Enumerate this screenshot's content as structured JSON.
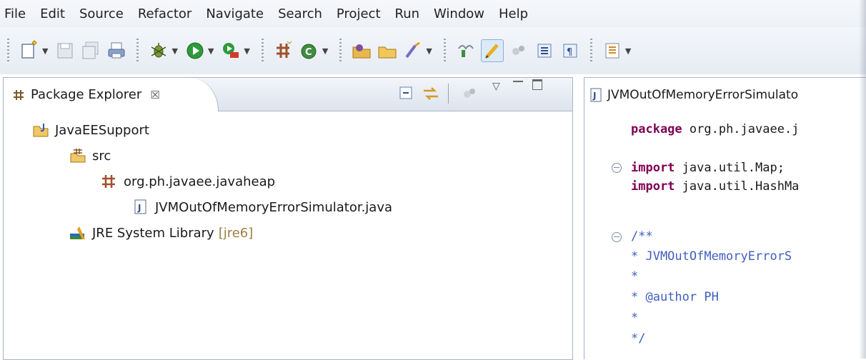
{
  "menu": [
    "File",
    "Edit",
    "Source",
    "Refactor",
    "Navigate",
    "Search",
    "Project",
    "Run",
    "Window",
    "Help"
  ],
  "toolbar": {
    "icons": [
      "new-wizard-icon",
      "save-icon",
      "save-all-icon",
      "print-icon",
      "debug-icon",
      "run-icon",
      "external-tools-icon",
      "new-java-package-icon",
      "new-java-class-icon",
      "open-type-icon",
      "open-task-icon",
      "search-icon",
      "toggle-breadcrumb-icon",
      "mark-occurrences-icon",
      "block-selection-icon",
      "show-source-icon",
      "show-whitespace-icon",
      "next-annotation-icon"
    ]
  },
  "package_explorer": {
    "title": "Package Explorer",
    "close_glyph": "☒",
    "tree": [
      {
        "label": "JavaEESupport",
        "icon": "java-project-icon",
        "depth": 0
      },
      {
        "label": "src",
        "icon": "source-folder-icon",
        "depth": 1
      },
      {
        "label": "org.ph.javaee.javaheap",
        "icon": "package-icon",
        "depth": 2
      },
      {
        "label": "JVMOutOfMemoryErrorSimulator.java",
        "icon": "java-file-icon",
        "depth": 3
      },
      {
        "label": "JRE System Library",
        "decoration": "[jre6]",
        "icon": "library-icon",
        "depth": 1
      }
    ]
  },
  "editor": {
    "tab_title": "JVMOutOfMemoryErrorSimulato",
    "lines": [
      {
        "kw": "package",
        "rest": " org.ph.javaee.j"
      },
      {
        "kw": "",
        "rest": ""
      },
      {
        "kw": "import",
        "rest": " java.util.Map;"
      },
      {
        "kw": "import",
        "rest": " java.util.HashMa"
      },
      {
        "kw": "",
        "rest": ""
      },
      {
        "comment": "/**"
      },
      {
        "comment": " * JVMOutOfMemoryErrorS"
      },
      {
        "comment": " *"
      },
      {
        "comment": " * @author PH"
      },
      {
        "comment": " *"
      },
      {
        "comment": " */"
      }
    ]
  }
}
